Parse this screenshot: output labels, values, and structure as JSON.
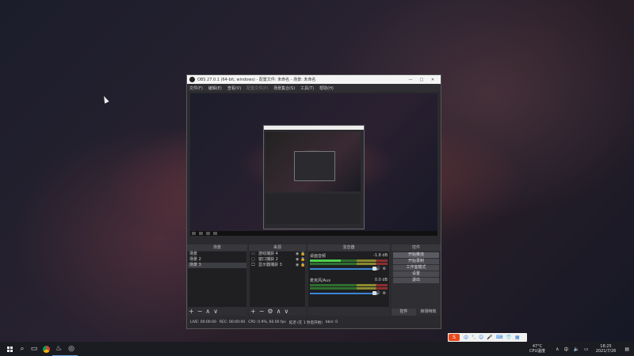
{
  "obs": {
    "title": "OBS 27.0.1 (64-bit, windows) - 配置文件: 未命名 - 场景: 未命名",
    "menu": [
      "文件(F)",
      "编辑(E)",
      "查看(V)",
      "配置文件(P)",
      "场景集合(S)",
      "工具(T)",
      "帮助(H)"
    ],
    "docks": {
      "scenes": "场景",
      "sources": "来源",
      "mixer": "混音器",
      "controls": "控件"
    },
    "scenes": [
      "场景",
      "场景 2",
      "场景 3"
    ],
    "sources": [
      {
        "icon": "▭",
        "label": "游戏捕获 4"
      },
      {
        "icon": "▢",
        "label": "窗口捕获 2"
      },
      {
        "icon": "🖵",
        "label": "显示器捕获 3"
      }
    ],
    "mixer": [
      {
        "name": "桌面音频",
        "db": "-1.8 dB"
      },
      {
        "name": "麦克风/Aux",
        "db": "0.0 dB"
      }
    ],
    "controls": [
      "开始推流",
      "开始录制",
      "工作室模式",
      "设置",
      "退出"
    ],
    "control_tabs": [
      "控件",
      "转场特效"
    ],
    "status": [
      "LIVE: 00:00:00",
      "REC: 00:00:00",
      "CPU: 0.9%, 60.00 fps",
      "延迟 (在 1 秒后开始)",
      "kb/s: 0"
    ]
  },
  "taskbar": {
    "temp": "47°C",
    "temp_label": "CPU温度",
    "time": "18:25",
    "date": "2021/7/26"
  },
  "ime": {
    "logo": "S",
    "items": [
      "中",
      "°,",
      "☺",
      "🎤",
      "⌨",
      "👕",
      "▦"
    ]
  }
}
